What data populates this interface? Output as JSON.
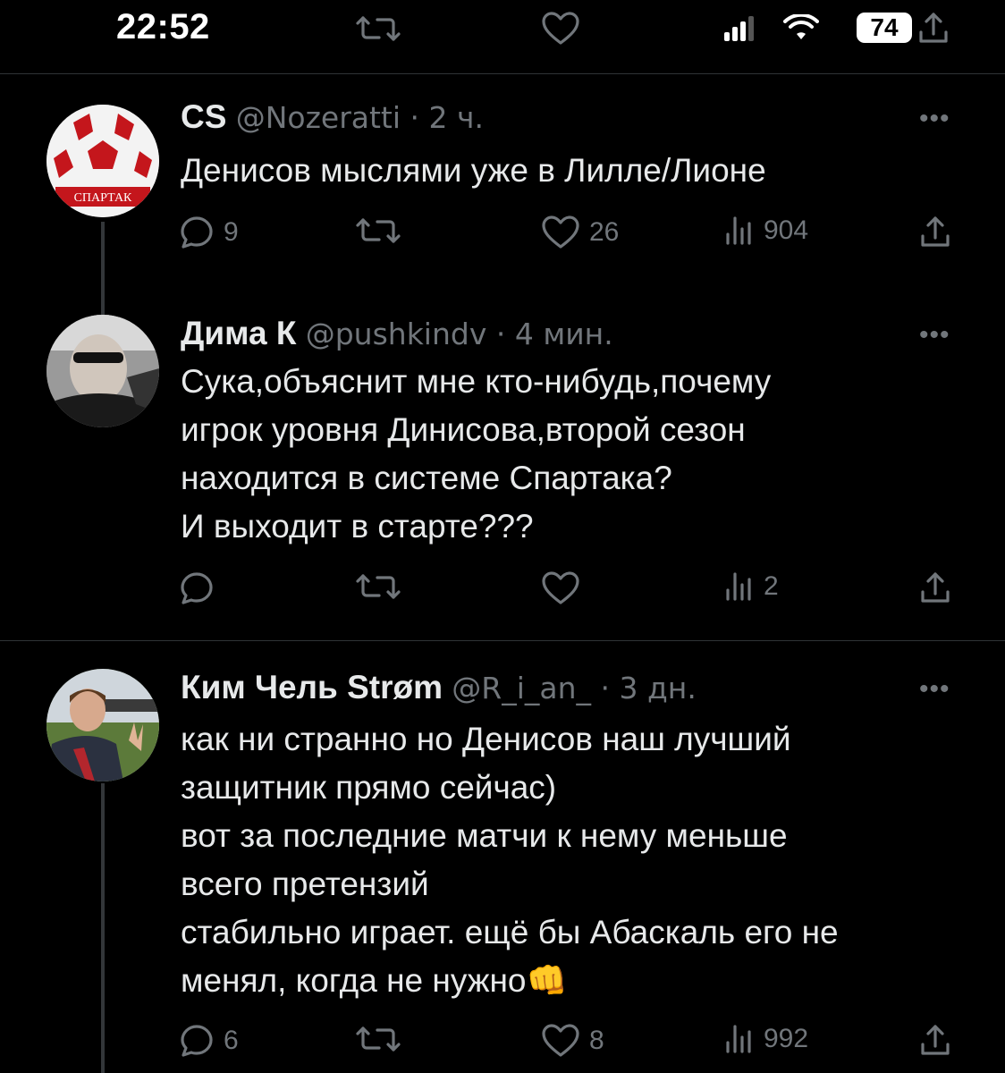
{
  "status_bar": {
    "time": "22:52",
    "battery": "74"
  },
  "tweets": [
    {
      "name": "CS",
      "handle": "@Nozeratti · 2 ч.",
      "text": "Денисов мыслями уже в Лилле/Лионе",
      "avatar_label": "СПАРТАК",
      "replies": "9",
      "retweets": "",
      "likes": "26",
      "views": "904"
    },
    {
      "name": "Дима К",
      "handle": "@pushkindv · 4 мин.",
      "text": "Сука,объяснит мне кто-нибудь,почему\nигрок уровня Динисова,второй сезон\nнаходится в системе Спартака?\nИ выходит в старте???",
      "replies": "",
      "retweets": "",
      "likes": "",
      "views": "2"
    },
    {
      "name": "Ким Чель Strøm",
      "handle": "@R_i_an_ · 3 дн.",
      "text": "как ни странно но Денисов наш лучший\nзащитник прямо сейчас)\nвот за последние матчи к нему меньше\nвсего претензий\nстабильно играет. ещё бы Абаскаль его не\nменял, когда не нужно👊",
      "replies": "6",
      "retweets": "",
      "likes": "8",
      "views": "992"
    }
  ],
  "colors": {
    "background": "#000000",
    "text": "#e7e9ea",
    "muted": "#71767b",
    "divider": "#2f3336"
  }
}
